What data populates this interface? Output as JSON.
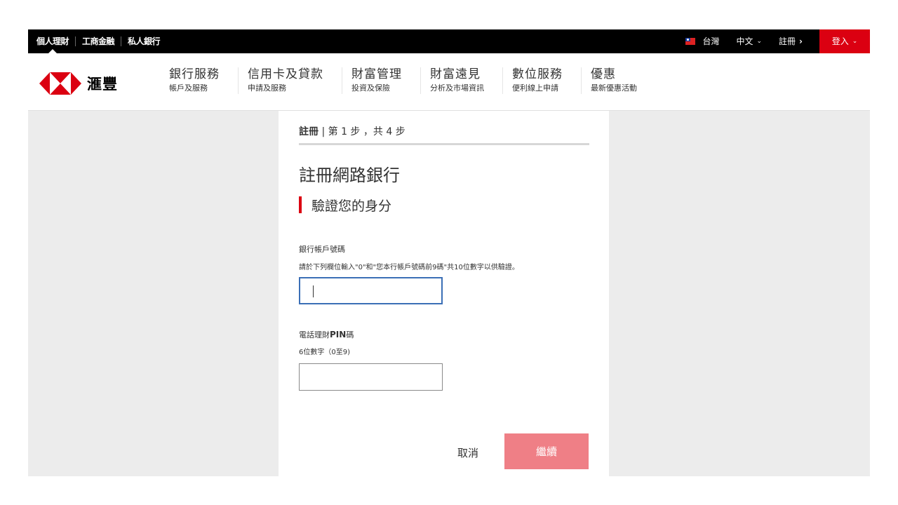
{
  "topbar": {
    "tabs": [
      "個人理財",
      "工商金融",
      "私人銀行"
    ],
    "region": "台灣",
    "language": "中文",
    "register": "註冊",
    "login": "登入"
  },
  "brand": {
    "name": "滙豐",
    "colors": {
      "red": "#db0011",
      "black": "#000000"
    }
  },
  "nav": [
    {
      "main": "銀行服務",
      "sub": "帳戶及服務"
    },
    {
      "main": "信用卡及貸款",
      "sub": "申請及服務"
    },
    {
      "main": "財富管理",
      "sub": "投資及保險"
    },
    {
      "main": "財富遠見",
      "sub": "分析及市場資訊"
    },
    {
      "main": "數位服務",
      "sub": "便利線上申請"
    },
    {
      "main": "優惠",
      "sub": "最新優惠活動"
    }
  ],
  "form": {
    "step_title": "註冊",
    "step_text": "第 1 步 ，共 4 步",
    "heading": "註冊網路銀行",
    "subheading": "驗證您的身分",
    "account_label": "銀行帳戶號碼",
    "account_hint": "請於下列欄位輸入\"0\"和\"您本行帳戶號碼前9碼\"共10位數字以供驗證。",
    "account_value": "",
    "pin_label_prefix": "電話理財",
    "pin_label_bold": "PIN",
    "pin_label_suffix": "碼",
    "pin_hint": "6位數字（0至9)",
    "pin_value": "",
    "cancel": "取消",
    "continue": "繼續"
  }
}
